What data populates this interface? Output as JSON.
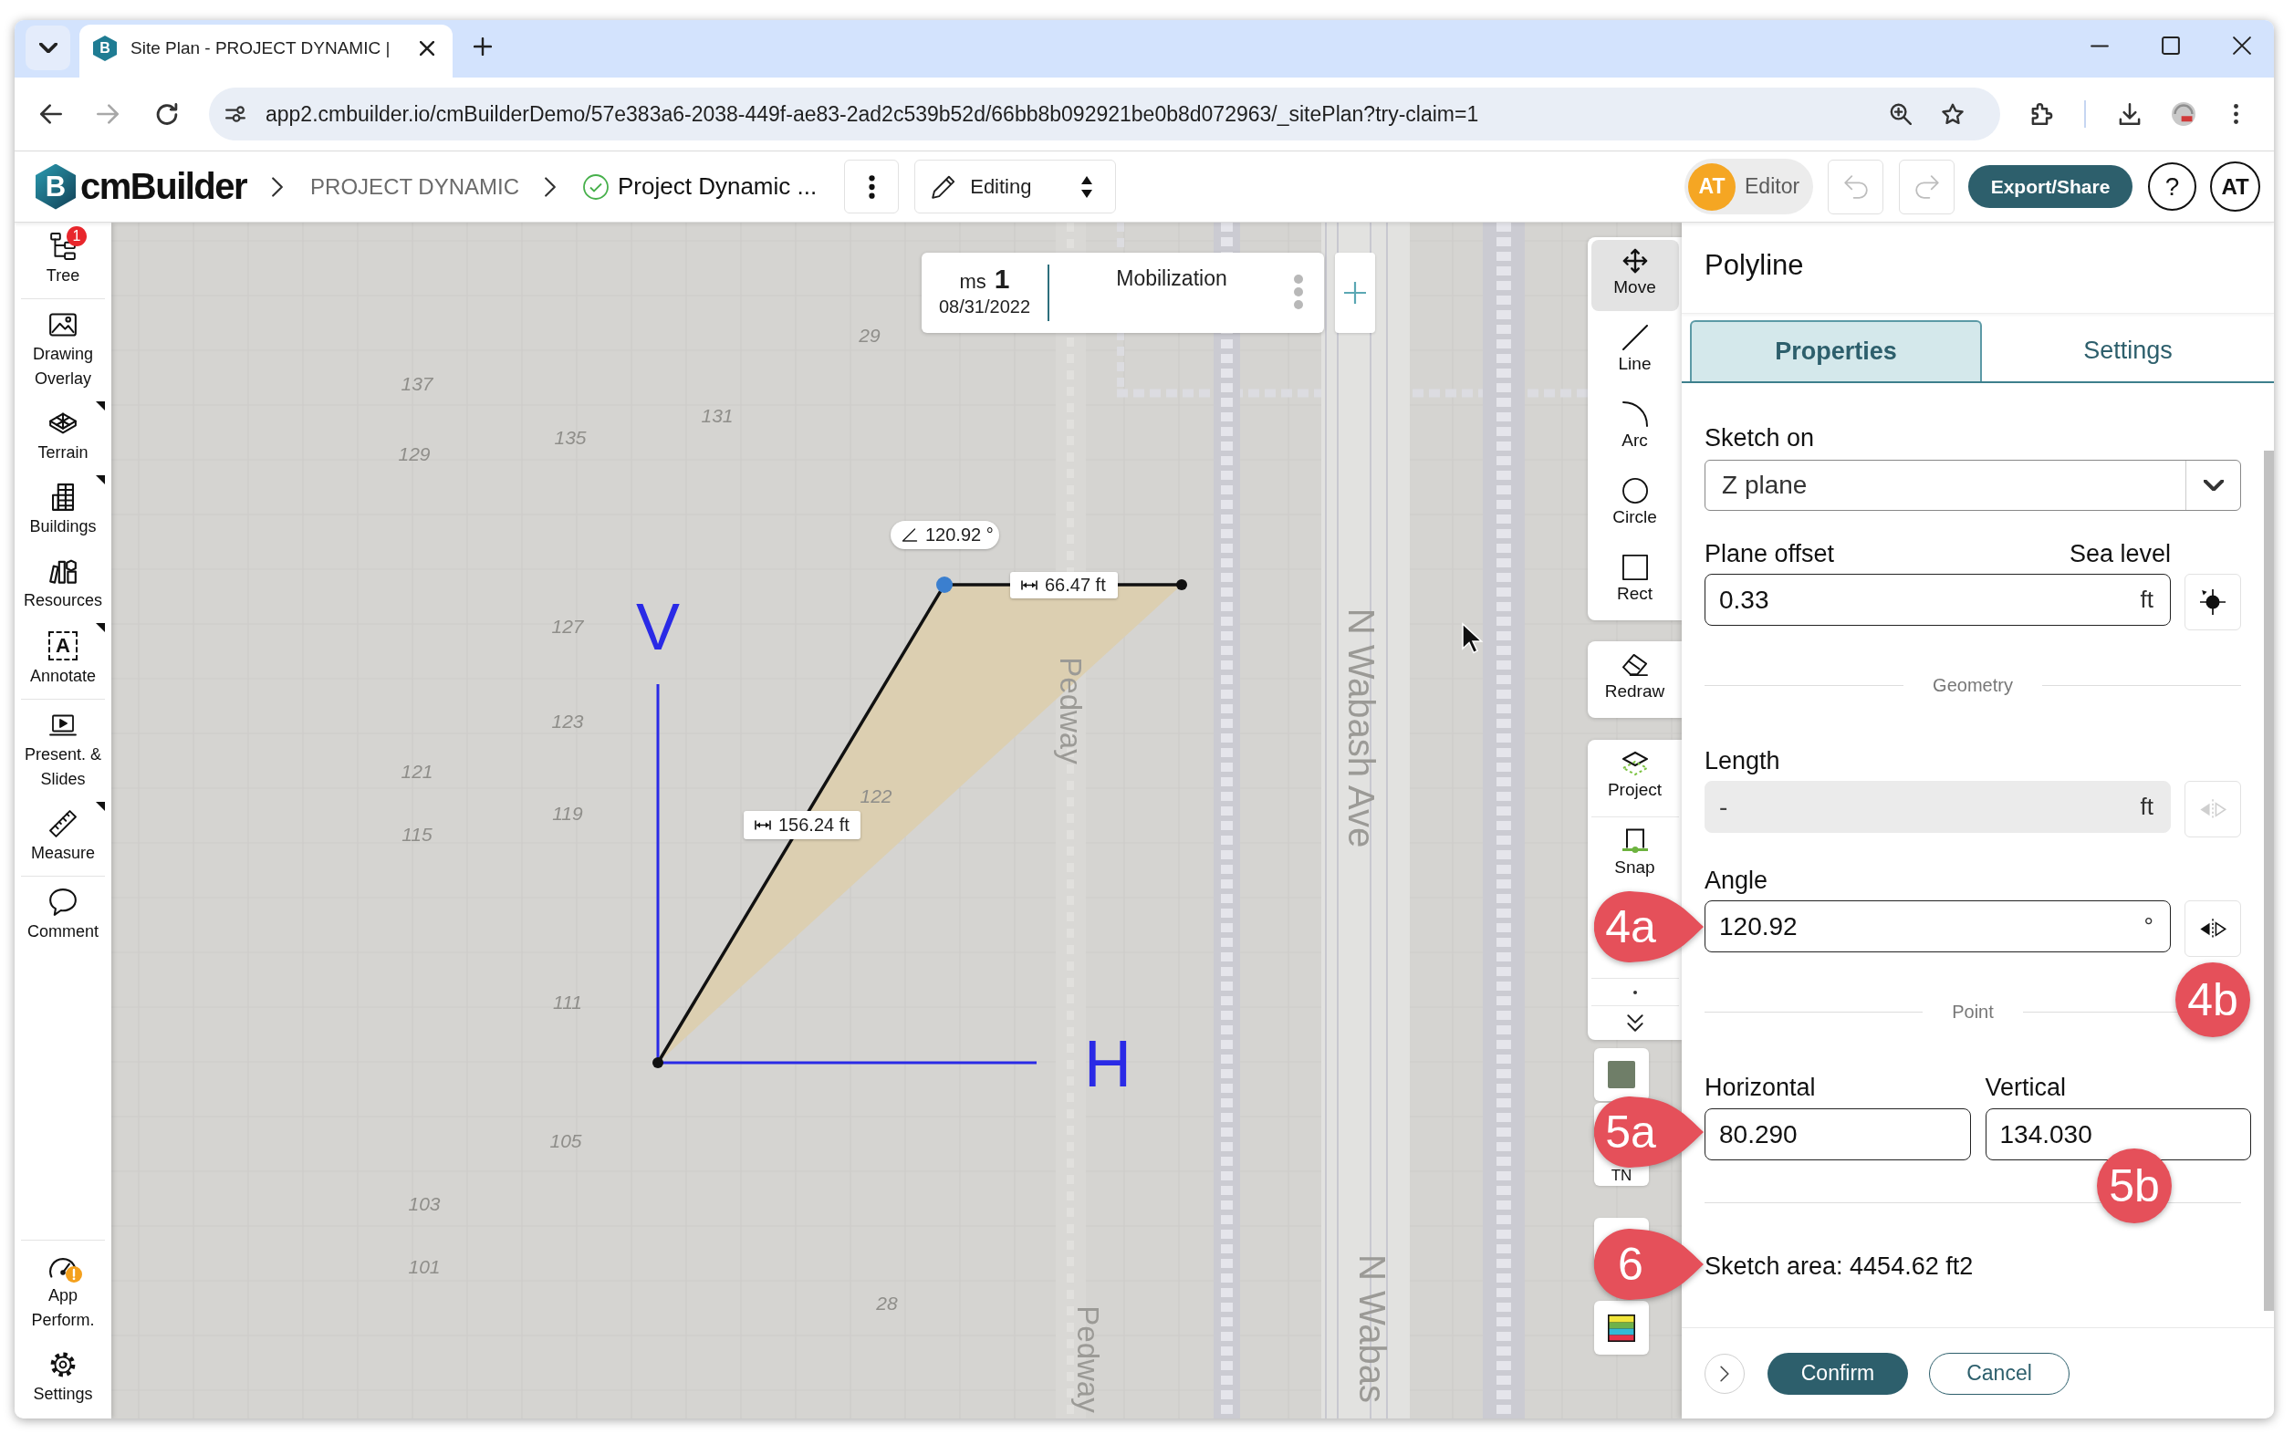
{
  "browser": {
    "favicon": "B",
    "tab_title": "Site Plan - PROJECT DYNAMIC |",
    "url": "app2.cmbuilder.io/cmBuilderDemo/57e383a6-2038-449f-ae83-2ad2c539b52d/66bb8b092921be0b8d072963/_sitePlan?try-claim=1",
    "forward_disabled": true
  },
  "header": {
    "logo_mark": "B",
    "logo": "cmBuilder",
    "breadcrumbs": [
      {
        "label": "PROJECT DYNAMIC",
        "kind": "project"
      },
      {
        "label": "Project Dynamic ...",
        "kind": "plan"
      }
    ],
    "mode": "Editing",
    "user": {
      "initials": "AT",
      "role": "Editor"
    },
    "undo_disabled": true,
    "redo_disabled": true,
    "export": "Export/Share",
    "help": "?",
    "avatar": "AT"
  },
  "sidebar": {
    "sections": [
      {
        "items": [
          {
            "label": "Tree",
            "badge": "1",
            "submenu": false
          }
        ]
      },
      {
        "items": [
          {
            "label": "Drawing Overlay",
            "submenu": false
          },
          {
            "label": "Terrain",
            "submenu": true
          },
          {
            "label": "Buildings",
            "submenu": true
          },
          {
            "label": "Resources",
            "submenu": false
          },
          {
            "label": "Annotate",
            "submenu": true,
            "glyph": "A"
          }
        ]
      },
      {
        "items": [
          {
            "label": "Present. & Slides",
            "submenu": false
          },
          {
            "label": "Measure",
            "submenu": true
          }
        ]
      },
      {
        "items": [
          {
            "label": "Comment",
            "submenu": false
          }
        ]
      }
    ],
    "footer": [
      {
        "label": "App Perform.",
        "warning": true
      },
      {
        "label": "Settings",
        "warning": false
      }
    ]
  },
  "milestone": {
    "prefix": "ms",
    "number": "1",
    "date": "08/31/2022",
    "name": "Mobilization"
  },
  "map": {
    "labels": [
      "137",
      "129",
      "135",
      "131",
      "29",
      "127",
      "123",
      "121",
      "119",
      "115",
      "122",
      "111",
      "105",
      "103",
      "101",
      "28"
    ],
    "streets": [
      {
        "name": "Pedway"
      },
      {
        "name": "N Wabash Ave"
      },
      {
        "name": "Pedway"
      },
      {
        "name": "N Wabas"
      }
    ]
  },
  "sketch": {
    "angle": "120.92 °",
    "segments": [
      "66.47 ft",
      "156.24 ft"
    ],
    "axes": [
      "V",
      "H"
    ]
  },
  "tools": {
    "draw": [
      {
        "label": "Move",
        "selected": true
      },
      {
        "label": "Line",
        "selected": false
      },
      {
        "label": "Arc",
        "selected": false
      },
      {
        "label": "Circle",
        "selected": false
      },
      {
        "label": "Rect",
        "selected": false
      }
    ],
    "edit": [
      {
        "label": "Redraw"
      }
    ],
    "assist": [
      {
        "label": "Project"
      },
      {
        "label": "Snap"
      }
    ],
    "tiles": [
      {
        "kind": "map"
      },
      {
        "kind": "north",
        "label": "TN"
      },
      {
        "kind": "blank"
      },
      {
        "kind": "layers"
      }
    ]
  },
  "panel": {
    "title": "Polyline",
    "tabs": [
      {
        "label": "Properties",
        "selected": true
      },
      {
        "label": "Settings",
        "selected": false
      }
    ],
    "fields": [
      {
        "kind": "select",
        "label": "Sketch on",
        "value": "Z plane"
      },
      {
        "kind": "input",
        "label": "Plane offset",
        "note": "Sea level",
        "value": "0.33",
        "unit": "ft",
        "disabled": false,
        "button": {
          "kind": "target"
        }
      },
      {
        "kind": "section",
        "label": "Geometry"
      },
      {
        "kind": "input",
        "label": "Length",
        "value": "-",
        "unit": "ft",
        "disabled": true,
        "button": {
          "kind": "flip"
        }
      },
      {
        "kind": "input",
        "label": "Angle",
        "value": "120.92",
        "unit": "°",
        "disabled": false,
        "button": {
          "kind": "flip"
        }
      },
      {
        "kind": "section",
        "label": "Point"
      },
      {
        "kind": "pair",
        "items": [
          {
            "label": "Horizontal",
            "value": "80.290"
          },
          {
            "label": "Vertical",
            "value": "134.030"
          }
        ]
      },
      {
        "kind": "rule"
      },
      {
        "kind": "text",
        "text": "Sketch area: 4454.62 ft2"
      }
    ],
    "buttons": [
      {
        "label": "Confirm",
        "kind": "primary"
      },
      {
        "label": "Cancel",
        "kind": "secondary"
      }
    ]
  },
  "callouts": [
    {
      "label": "4a",
      "kind": "pointer"
    },
    {
      "label": "4b",
      "kind": "circle"
    },
    {
      "label": "5a",
      "kind": "pointer"
    },
    {
      "label": "5b",
      "kind": "circle"
    },
    {
      "label": "6",
      "kind": "pointer"
    }
  ]
}
